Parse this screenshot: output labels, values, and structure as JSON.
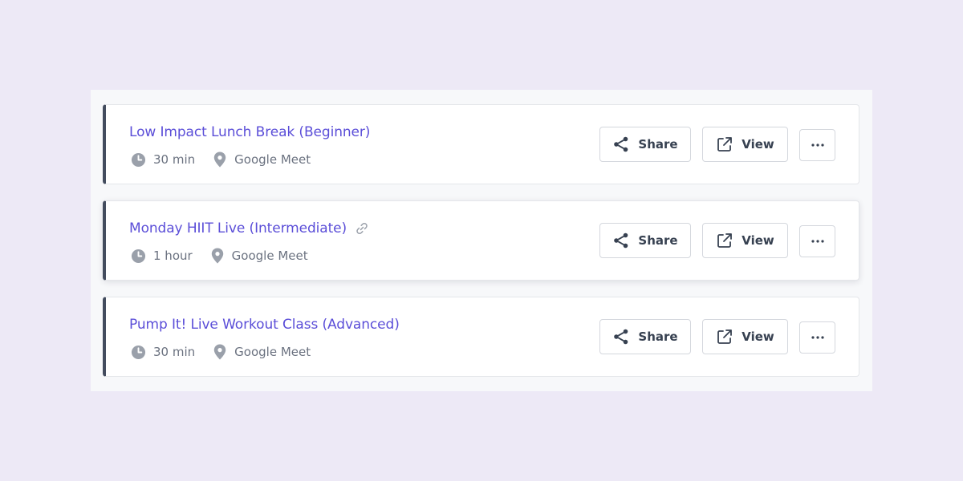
{
  "colors": {
    "page_background": "#ede9f6",
    "title": "#5b4ed8",
    "accent_bar": "#434c5e",
    "meta_text": "#6b7280",
    "icon_gray": "#9aa0aa"
  },
  "events": [
    {
      "title": "Low Impact Lunch Break (Beginner)",
      "duration": "30 min",
      "location": "Google Meet",
      "has_link_icon": false
    },
    {
      "title": "Monday HIIT Live (Intermediate)",
      "duration": "1 hour",
      "location": "Google Meet",
      "has_link_icon": true
    },
    {
      "title": "Pump It! Live Workout Class (Advanced)",
      "duration": "30 min",
      "location": "Google Meet",
      "has_link_icon": false
    }
  ],
  "actions": {
    "share_label": "Share",
    "view_label": "View",
    "more_icon": "ellipsis-icon",
    "share_icon": "share-icon",
    "view_icon": "external-link-icon"
  },
  "icons": {
    "duration": "clock-icon",
    "location": "map-pin-icon",
    "link": "link-icon"
  }
}
